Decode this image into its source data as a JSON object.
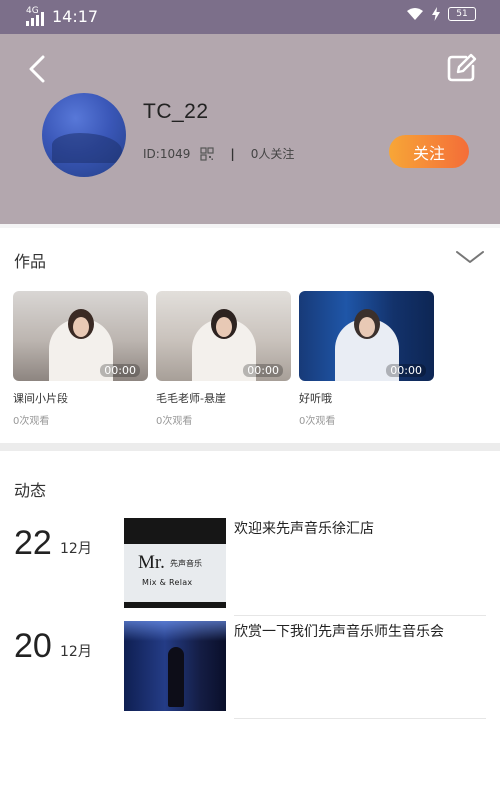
{
  "status_bar": {
    "network": "4G",
    "time": "14:17",
    "battery": "51"
  },
  "profile": {
    "username": "TC_22",
    "id_text": "ID:1049",
    "followers": "0人关注",
    "follow_label": "关注"
  },
  "works": {
    "title": "作品",
    "videos": [
      {
        "title": "课间小片段",
        "views": "0次观看",
        "duration": "00:00"
      },
      {
        "title": "毛毛老师-悬崖",
        "views": "0次观看",
        "duration": "00:00"
      },
      {
        "title": "好听哦",
        "views": "0次观看",
        "duration": "00:00"
      }
    ]
  },
  "feed": {
    "title": "动态",
    "items": [
      {
        "day": "22",
        "month": "12月",
        "text": "欢迎来先声音乐徐汇店",
        "thumb_sign": {
          "mr": "Mr.",
          "cn": "先声音乐",
          "mix": "Mix & Relax"
        }
      },
      {
        "day": "20",
        "month": "12月",
        "text": "欣赏一下我们先声音乐师生音乐会"
      }
    ]
  },
  "colors": {
    "status_bar": "#7c6f8a",
    "header_bg": "#b3a7ae",
    "follow_gradient_start": "#f7a637",
    "follow_gradient_end": "#f46d38"
  }
}
